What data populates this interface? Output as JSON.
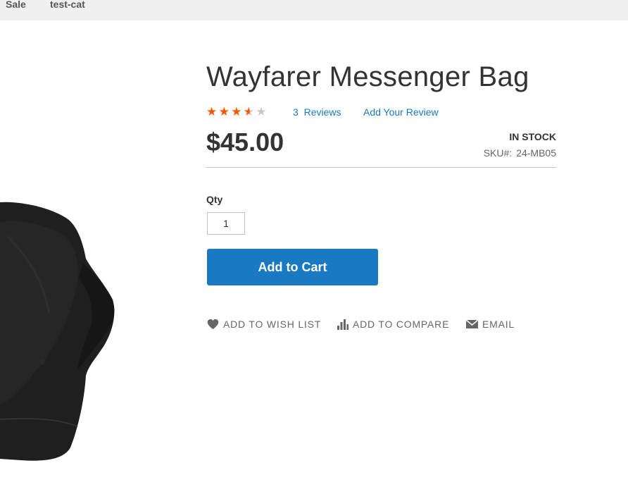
{
  "nav": {
    "items": [
      {
        "label": "Sale"
      },
      {
        "label": "test-cat"
      }
    ]
  },
  "product": {
    "title": "Wayfarer Messenger Bag",
    "rating": {
      "value": 3.5,
      "max": 5
    },
    "reviews_count": "3",
    "reviews_word": "Reviews",
    "add_review_label": "Add Your Review",
    "price": "$45.00",
    "stock_status": "In stock",
    "sku_label": "SKU#:",
    "sku_value": "24-MB05"
  },
  "form": {
    "qty_label": "Qty",
    "qty_value": "1",
    "add_to_cart_label": "Add to Cart"
  },
  "actions": {
    "wishlist_label": "Add to Wish List",
    "compare_label": "Add to Compare",
    "email_label": "Email"
  },
  "colors": {
    "accent": "#1979c3",
    "star_filled": "#ff5501",
    "star_empty": "#c7c7c7",
    "nav_bg": "#f0f0f0"
  },
  "icons": {
    "wishlist": "heart-icon",
    "compare": "bar-chart-icon",
    "email": "envelope-icon",
    "rating": "star-icon"
  }
}
